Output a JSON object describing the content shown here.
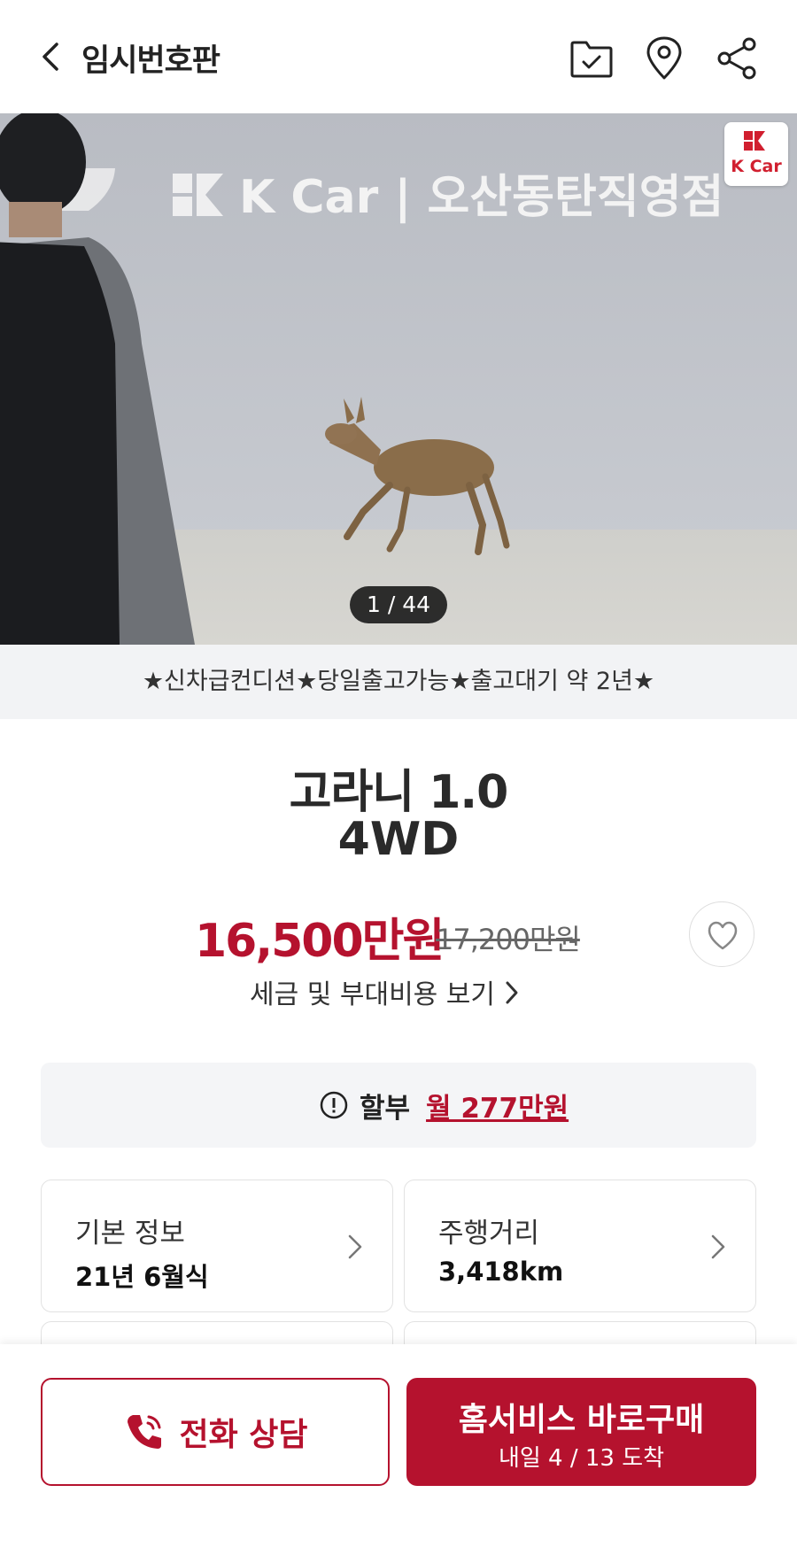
{
  "header": {
    "title": "임시번호판",
    "icons": [
      "back-icon",
      "folder-check-icon",
      "location-pin-icon",
      "share-icon"
    ]
  },
  "photo": {
    "sign_text": "K Car | 오산동탄직영점",
    "badge_text": "K Car",
    "counter": "1 / 44"
  },
  "promo": "★신차급컨디션★당일출고가능★출고대기 약 2년★",
  "car": {
    "name": "고라니 1.0",
    "trim": "4WD",
    "price": "16,500만원",
    "old_price": "17,200만원",
    "tax_link": "세금 및 부대비용 보기"
  },
  "installment": {
    "label": "할부",
    "value": "월 277만원"
  },
  "cards": [
    {
      "label": "기본 정보",
      "value": "21년 6월식"
    },
    {
      "label": "주행거리",
      "value": "3,418km"
    }
  ],
  "bottom": {
    "call_label": "전화 상담",
    "buy_label": "홈서비스 바로구매",
    "buy_sub": "내일 4 / 13 도착"
  },
  "colors": {
    "brand_red": "#b5122e",
    "light_gray": "#f4f5f7"
  }
}
